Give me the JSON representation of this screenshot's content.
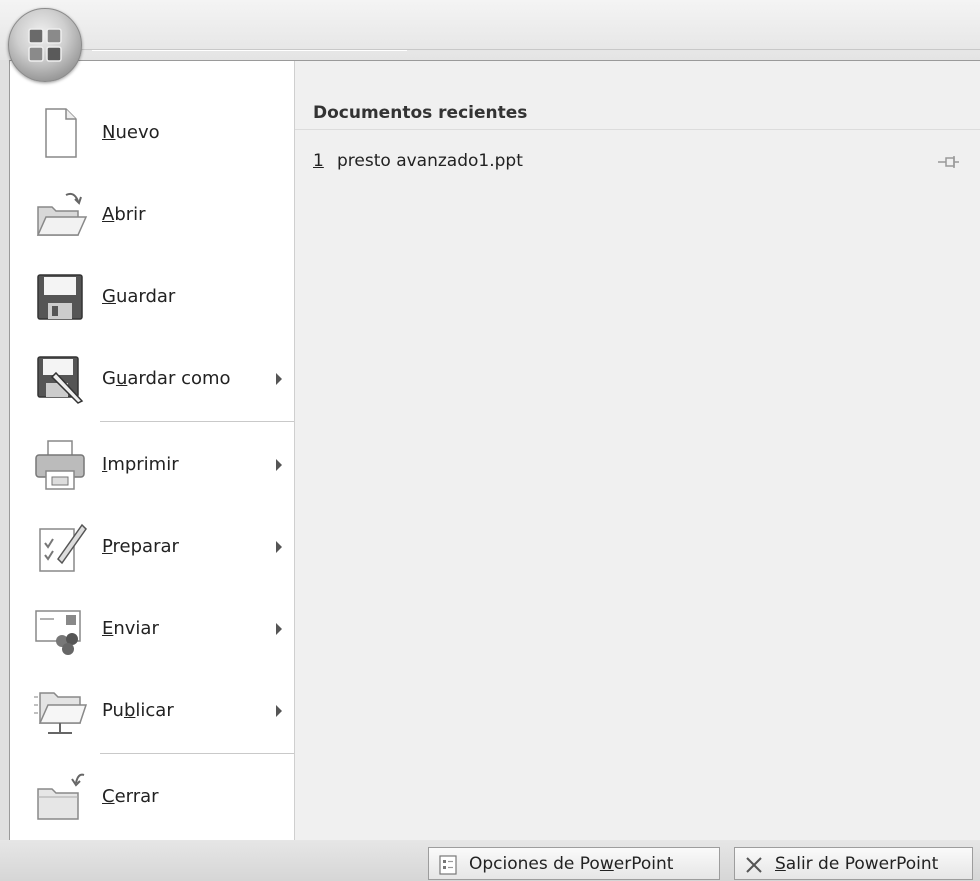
{
  "menu": {
    "items": [
      {
        "pre": "",
        "key": "N",
        "post": "uevo",
        "has_submenu": false,
        "icon": "new-document-icon"
      },
      {
        "pre": "",
        "key": "A",
        "post": "brir",
        "has_submenu": false,
        "icon": "open-folder-icon"
      },
      {
        "pre": "",
        "key": "G",
        "post": "uardar",
        "has_submenu": false,
        "icon": "save-disk-icon"
      },
      {
        "pre": "G",
        "key": "u",
        "post": "ardar como",
        "has_submenu": true,
        "icon": "save-as-icon"
      },
      {
        "pre": "",
        "key": "I",
        "post": "mprimir",
        "has_submenu": true,
        "icon": "printer-icon"
      },
      {
        "pre": "",
        "key": "P",
        "post": "reparar",
        "has_submenu": true,
        "icon": "prepare-document-icon"
      },
      {
        "pre": "",
        "key": "E",
        "post": "nviar",
        "has_submenu": true,
        "icon": "send-icon"
      },
      {
        "pre": "Pu",
        "key": "b",
        "post": "licar",
        "has_submenu": true,
        "icon": "publish-icon"
      },
      {
        "pre": "",
        "key": "C",
        "post": "errar",
        "has_submenu": false,
        "icon": "close-folder-icon"
      }
    ]
  },
  "recent": {
    "title": "Documentos recientes",
    "items": [
      {
        "number": "1",
        "name": "presto avanzado1.ppt"
      }
    ]
  },
  "footer": {
    "options": {
      "pre": "Opciones de Po",
      "key": "w",
      "post": "erPoint"
    },
    "exit": {
      "pre": "",
      "key": "S",
      "post": "alir de PowerPoint"
    }
  },
  "colors": {
    "menu_bg": "#ffffff",
    "recent_bg": "#f0f0f0",
    "chrome_bg": "#e8e8e8"
  }
}
